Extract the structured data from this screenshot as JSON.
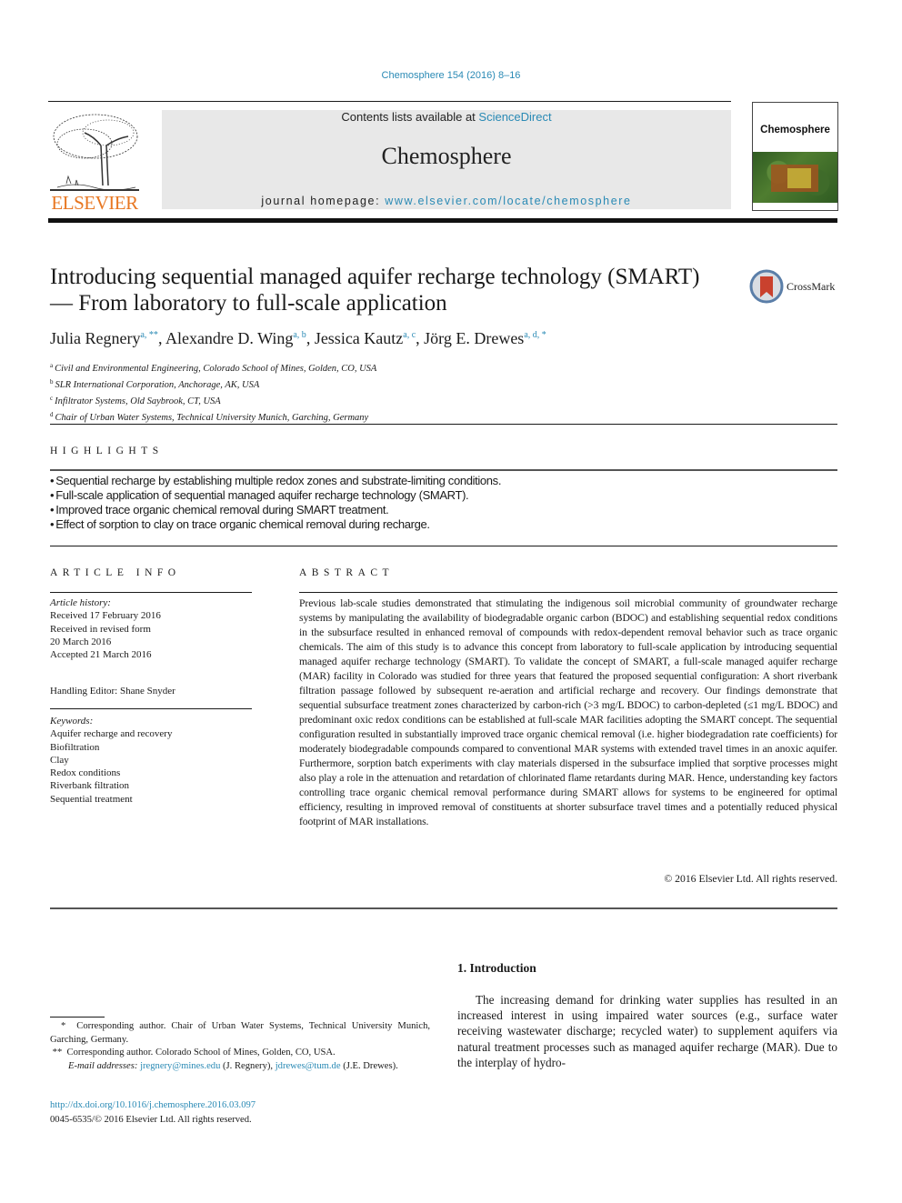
{
  "header": {
    "citation": "Chemosphere 154 (2016) 8–16",
    "contents_prefix": "Contents lists available at ",
    "contents_link": "ScienceDirect",
    "journal_name": "Chemosphere",
    "homepage_prefix": "journal homepage: ",
    "homepage_link": "www.elsevier.com/locate/chemosphere",
    "publisher_logo_text": "ELSEVIER",
    "cover_title": "Chemosphere",
    "colors": {
      "link": "#2a8ab5",
      "elsevier_orange": "#e87722",
      "banner_bg": "#e8e8e8"
    }
  },
  "article": {
    "title_line1": "Introducing sequential managed aquifer recharge technology (SMART)",
    "title_line2": "— From laboratory to full-scale application",
    "crossmark_label": "CrossMark",
    "authors": [
      {
        "name": "Julia Regnery",
        "marks": "a, **"
      },
      {
        "name": "Alexandre D. Wing",
        "marks": "a, b"
      },
      {
        "name": "Jessica Kautz",
        "marks": "a, c"
      },
      {
        "name": "Jörg E. Drewes",
        "marks": "a, d, *"
      }
    ],
    "affiliations": [
      {
        "mark": "a",
        "text": "Civil and Environmental Engineering, Colorado School of Mines, Golden, CO, USA"
      },
      {
        "mark": "b",
        "text": "SLR International Corporation, Anchorage, AK, USA"
      },
      {
        "mark": "c",
        "text": "Infiltrator Systems, Old Saybrook, CT, USA"
      },
      {
        "mark": "d",
        "text": "Chair of Urban Water Systems, Technical University Munich, Garching, Germany"
      }
    ]
  },
  "highlights": {
    "heading": "HIGHLIGHTS",
    "items": [
      "Sequential recharge by establishing multiple redox zones and substrate-limiting conditions.",
      "Full-scale application of sequential managed aquifer recharge technology (SMART).",
      "Improved trace organic chemical removal during SMART treatment.",
      "Effect of sorption to clay on trace organic chemical removal during recharge."
    ]
  },
  "article_info": {
    "heading": "ARTICLE INFO",
    "history_label": "Article history:",
    "history": [
      "Received 17 February 2016",
      "Received in revised form",
      "20 March 2016",
      "Accepted 21 March 2016"
    ],
    "editor": "Handling Editor: Shane Snyder",
    "keywords_label": "Keywords:",
    "keywords": [
      "Aquifer recharge and recovery",
      "Biofiltration",
      "Clay",
      "Redox conditions",
      "Riverbank filtration",
      "Sequential treatment"
    ]
  },
  "abstract": {
    "heading": "ABSTRACT",
    "text": "Previous lab-scale studies demonstrated that stimulating the indigenous soil microbial community of groundwater recharge systems by manipulating the availability of biodegradable organic carbon (BDOC) and establishing sequential redox conditions in the subsurface resulted in enhanced removal of compounds with redox-dependent removal behavior such as trace organic chemicals. The aim of this study is to advance this concept from laboratory to full-scale application by introducing sequential managed aquifer recharge technology (SMART). To validate the concept of SMART, a full-scale managed aquifer recharge (MAR) facility in Colorado was studied for three years that featured the proposed sequential configuration: A short riverbank filtration passage followed by subsequent re-aeration and artificial recharge and recovery. Our findings demonstrate that sequential subsurface treatment zones characterized by carbon-rich (>3 mg/L BDOC) to carbon-depleted (≤1 mg/L BDOC) and predominant oxic redox conditions can be established at full-scale MAR facilities adopting the SMART concept. The sequential configuration resulted in substantially improved trace organic chemical removal (i.e. higher biodegradation rate coefficients) for moderately biodegradable compounds compared to conventional MAR systems with extended travel times in an anoxic aquifer. Furthermore, sorption batch experiments with clay materials dispersed in the subsurface implied that sorptive processes might also play a role in the attenuation and retardation of chlorinated flame retardants during MAR. Hence, understanding key factors controlling trace organic chemical removal performance during SMART allows for systems to be engineered for optimal efficiency, resulting in improved removal of constituents at shorter subsurface travel times and a potentially reduced physical footprint of MAR installations.",
    "copyright": "© 2016 Elsevier Ltd. All rights reserved."
  },
  "introduction": {
    "heading": "1.  Introduction",
    "text": "The increasing demand for drinking water supplies has resulted in an increased interest in using impaired water sources (e.g., surface water receiving wastewater discharge; recycled water) to supplement aquifers via natural treatment processes such as managed aquifer recharge (MAR). Due to the interplay of hydro-"
  },
  "footnotes": {
    "fn1_mark": "*",
    "fn1": "Corresponding author. Chair of Urban Water Systems, Technical University Munich, Garching, Germany.",
    "fn2_mark": "**",
    "fn2": "Corresponding author. Colorado School of Mines, Golden, CO, USA.",
    "email_label": "E-mail addresses:",
    "email1": "jregnery@mines.edu",
    "email1_owner": "(J. Regnery),",
    "email2": "jdrewes@tum.de",
    "email2_owner": "(J.E. Drewes).",
    "doi": "http://dx.doi.org/10.1016/j.chemosphere.2016.03.097",
    "issn": "0045-6535/© 2016 Elsevier Ltd. All rights reserved."
  }
}
